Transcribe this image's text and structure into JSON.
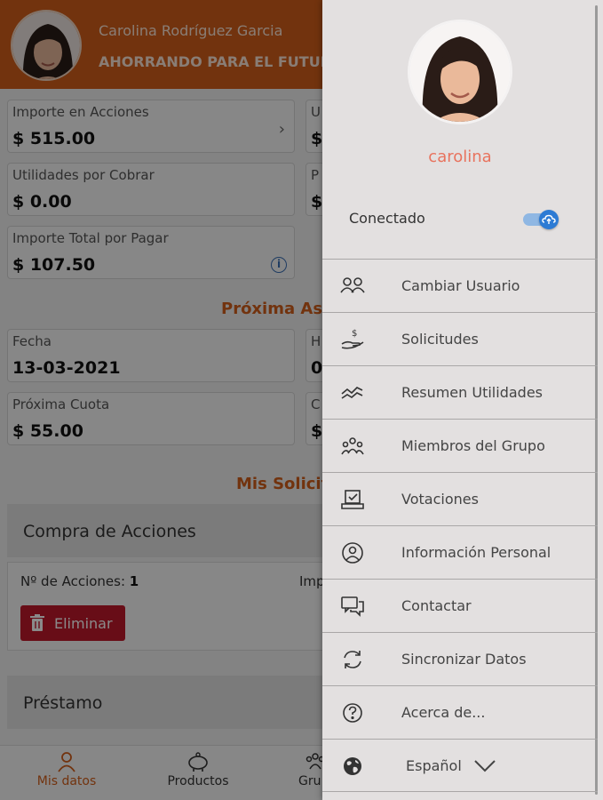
{
  "header": {
    "user_name": "Carolina Rodríguez Garcia",
    "group_name": "AHORRANDO PARA EL FUTURO"
  },
  "cards": {
    "importe_acciones": {
      "label": "Importe en Acciones",
      "value": "$ 515.00"
    },
    "utilidades_cobrar": {
      "label": "Utilidades por Cobrar",
      "value": "$ 0.00"
    },
    "importe_total_pagar": {
      "label": "Importe Total por Pagar",
      "value": "$ 107.50"
    },
    "fecha": {
      "label": "Fecha",
      "value": "13-03-2021"
    },
    "proxima_cuota": {
      "label": "Próxima Cuota",
      "value": "$ 55.00"
    },
    "right_col_partial": {
      "r1_label": "U",
      "r1_value": "$",
      "r2_label": "P",
      "r2_value": "$",
      "r3_label": "H",
      "r3_value": "0",
      "r4_label": "C",
      "r4_value": "$"
    }
  },
  "sections": {
    "proxima_asamblea": "Próxima Asa",
    "mis_solicitudes": "Mis Solicit"
  },
  "requests": [
    {
      "title": "Compra de Acciones",
      "acciones_label": "Nº de Acciones:",
      "acciones_value": "1",
      "importe_label": "Imp",
      "delete_label": "Eliminar"
    },
    {
      "title": "Préstamo"
    }
  ],
  "bottom_nav": [
    {
      "label": "Mis datos",
      "icon": "person-icon",
      "active": true
    },
    {
      "label": "Productos",
      "icon": "piggy-bank-icon",
      "active": false
    },
    {
      "label": "Gru",
      "icon": "group-icon",
      "active": false
    }
  ],
  "drawer": {
    "username": "carolina",
    "connection_label": "Conectado",
    "connected": true,
    "menu": [
      {
        "label": "Cambiar Usuario",
        "icon": "switch-user-icon"
      },
      {
        "label": "Solicitudes",
        "icon": "hand-money-icon"
      },
      {
        "label": "Resumen Utilidades",
        "icon": "trend-chart-icon"
      },
      {
        "label": "Miembros del Grupo",
        "icon": "group-members-icon"
      },
      {
        "label": "Votaciones",
        "icon": "ballot-icon"
      },
      {
        "label": "Información Personal",
        "icon": "user-circle-icon"
      },
      {
        "label": "Contactar",
        "icon": "chat-icon"
      },
      {
        "label": "Sincronizar Datos",
        "icon": "sync-icon"
      },
      {
        "label": "Acerca de...",
        "icon": "help-icon"
      }
    ],
    "language": {
      "label": "Español",
      "icon": "globe-icon"
    }
  },
  "colors": {
    "brand": "#d35f1a",
    "accent_user": "#e8735e",
    "toggle": "#2d7bd4",
    "delete": "#c0182b"
  }
}
